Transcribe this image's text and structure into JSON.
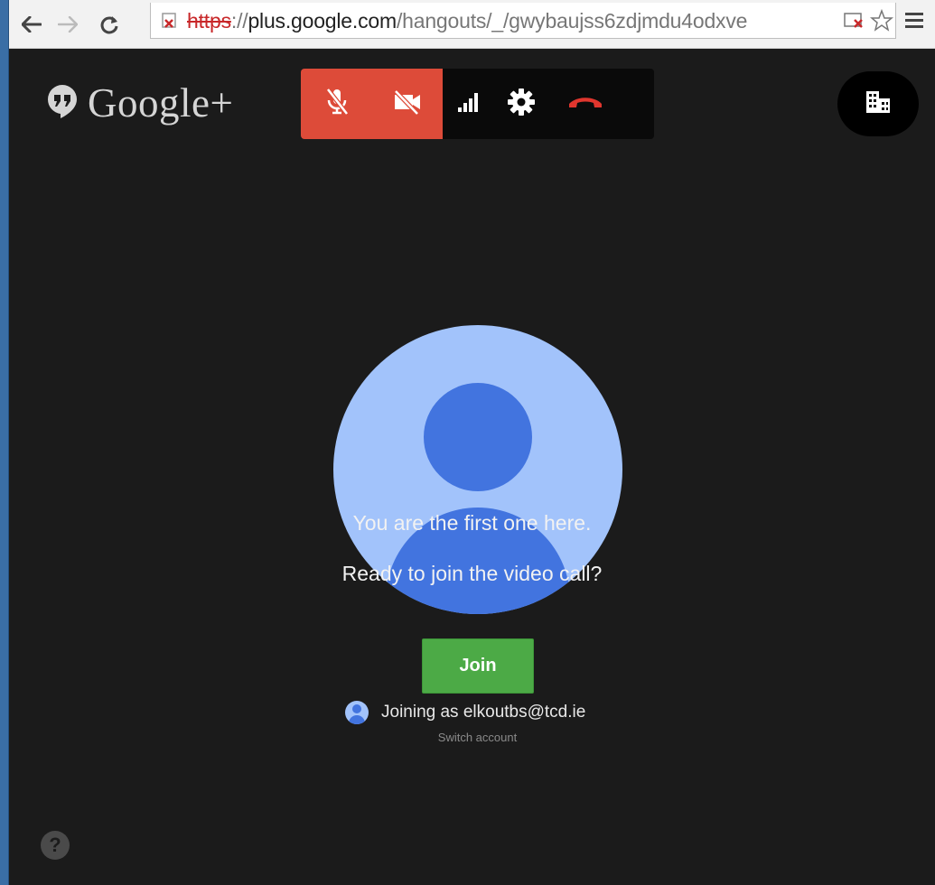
{
  "browser": {
    "url_scheme": "https",
    "url_separator": "://",
    "url_host": "plus.google.com",
    "url_path": "/hangouts/_/gwybaujss6zdjmdu4odxve"
  },
  "app": {
    "logo_text": "Google+",
    "message_line1": "You are the first one here.",
    "message_line2": "Ready to join the video call?",
    "join_label": "Join",
    "joining_as": "Joining as elkoutbs@tcd.ie",
    "switch_account": "Switch account",
    "help_label": "?"
  },
  "colors": {
    "accent_red": "#dd4b39",
    "join_green": "#4caa46",
    "avatar_light": "#a2c3fb",
    "avatar_dark": "#4274df",
    "background": "#1b1b1b"
  },
  "icons": {
    "call_bar": [
      "mic-off-icon",
      "camera-off-icon",
      "signal-bars-icon",
      "settings-gear-icon",
      "hang-up-icon"
    ],
    "office": "office-building-icon"
  }
}
